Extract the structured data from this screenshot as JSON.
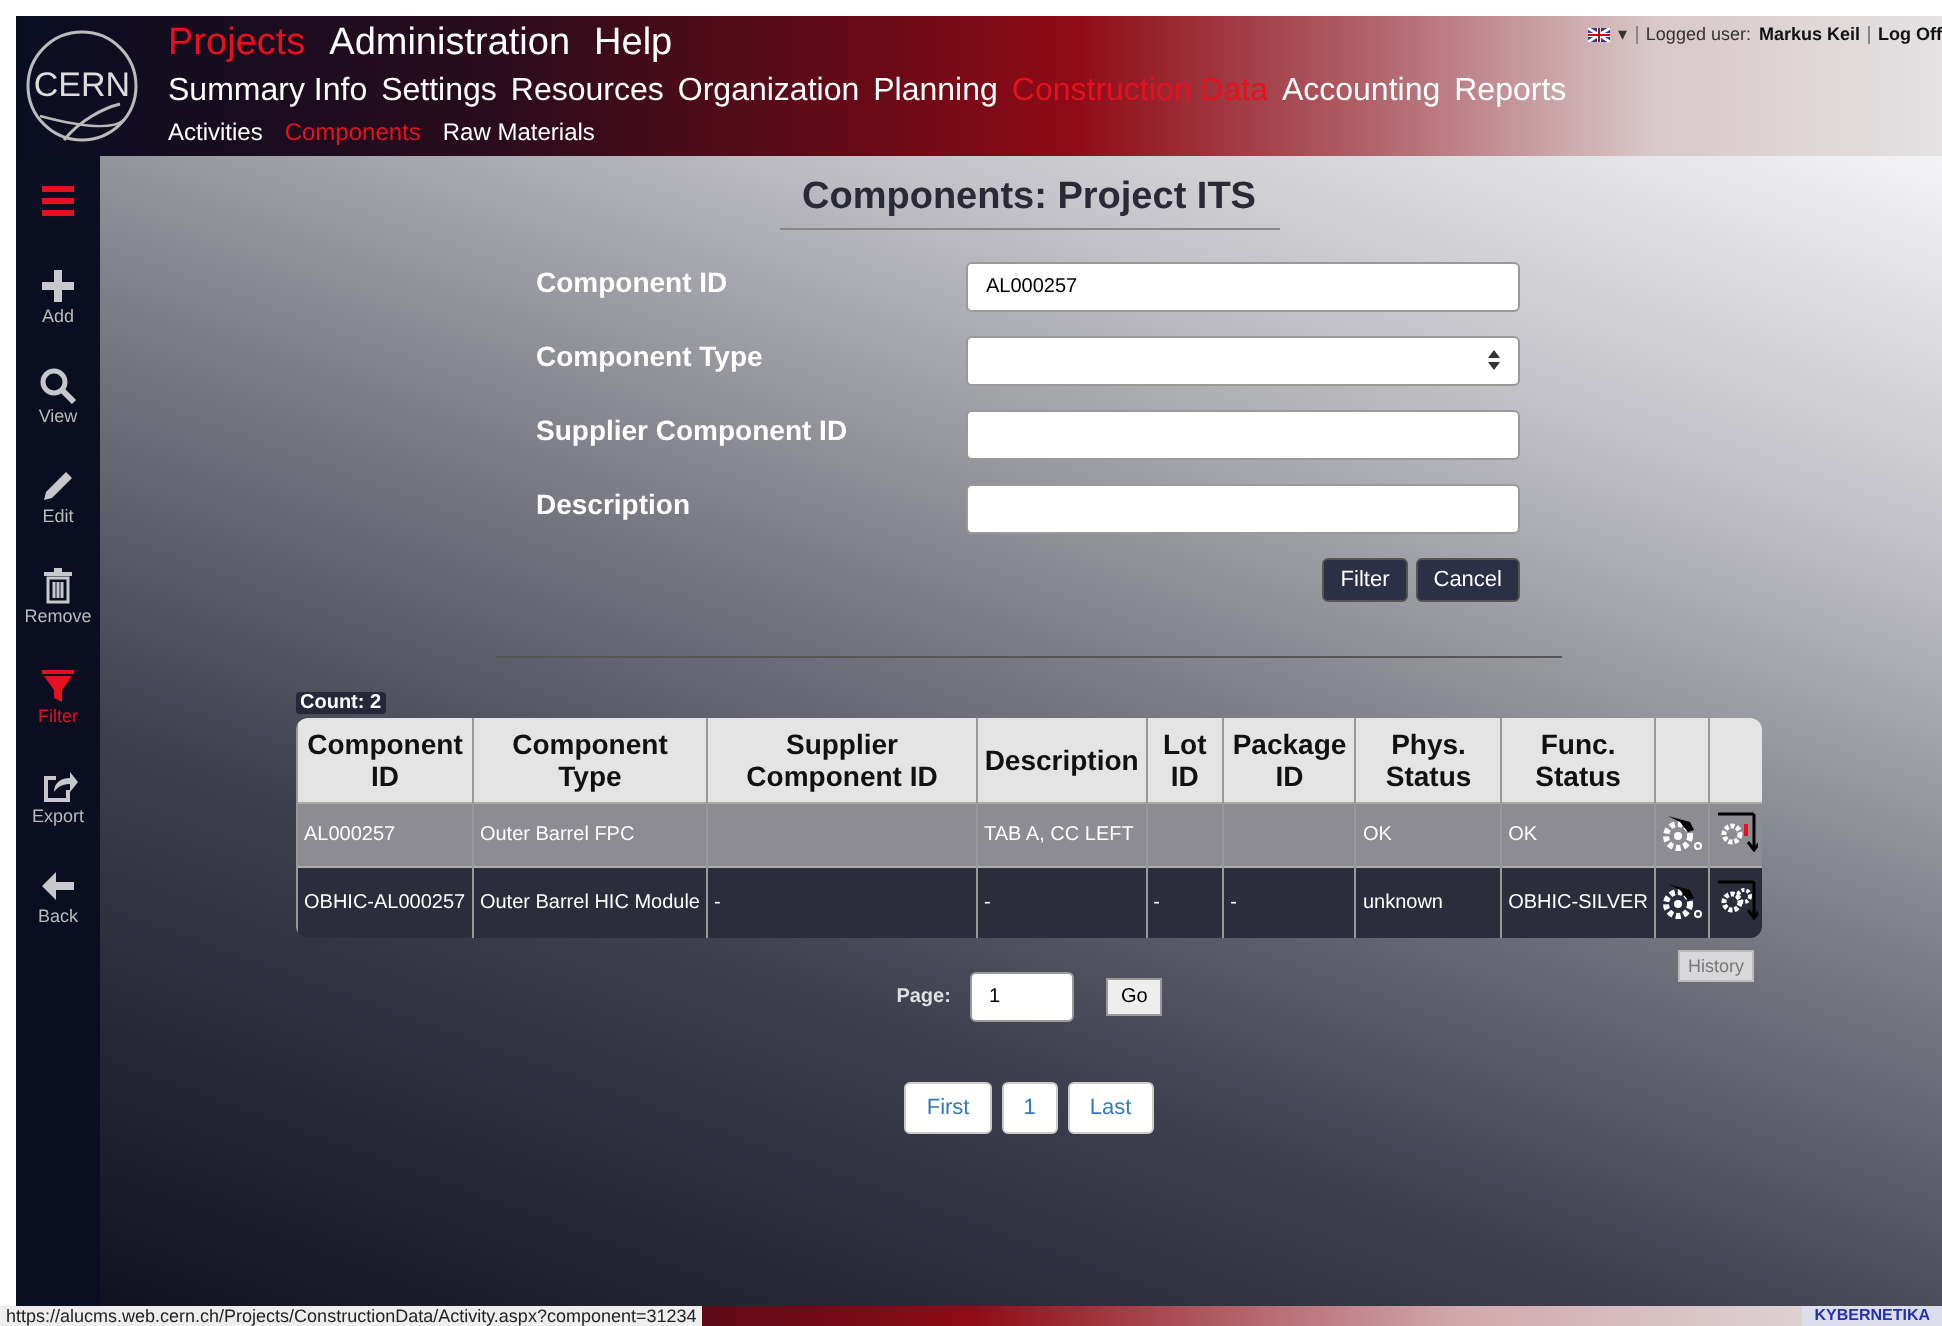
{
  "logo": {
    "text": "CERN"
  },
  "nav_main": [
    {
      "label": "Projects",
      "selected": true
    },
    {
      "label": "Administration",
      "selected": false
    },
    {
      "label": "Help",
      "selected": false
    }
  ],
  "nav_second": [
    {
      "label": "Summary Info",
      "selected": false
    },
    {
      "label": "Settings",
      "selected": false
    },
    {
      "label": "Resources",
      "selected": false
    },
    {
      "label": "Organization",
      "selected": false
    },
    {
      "label": "Planning",
      "selected": false
    },
    {
      "label": "Construction Data",
      "selected": true
    },
    {
      "label": "Accounting",
      "selected": false
    },
    {
      "label": "Reports",
      "selected": false
    }
  ],
  "nav_third": [
    {
      "label": "Activities",
      "selected": false
    },
    {
      "label": "Components",
      "selected": true
    },
    {
      "label": "Raw Materials",
      "selected": false
    }
  ],
  "user": {
    "caret": "▾",
    "label": "Logged user:",
    "name": "Markus Keil",
    "logoff": "Log Off"
  },
  "sidebar": {
    "items": [
      {
        "kind": "add",
        "label": "Add",
        "selected": false
      },
      {
        "kind": "view",
        "label": "View",
        "selected": false
      },
      {
        "kind": "edit",
        "label": "Edit",
        "selected": false
      },
      {
        "kind": "remove",
        "label": "Remove",
        "selected": false
      },
      {
        "kind": "filter",
        "label": "Filter",
        "selected": true
      },
      {
        "kind": "export",
        "label": "Export",
        "selected": false
      },
      {
        "kind": "back",
        "label": "Back",
        "selected": false
      }
    ]
  },
  "title": "Components: Project ITS",
  "form": {
    "fields": [
      {
        "kind": "text",
        "label": "Component ID",
        "value": "AL000257"
      },
      {
        "kind": "select",
        "label": "Component Type"
      },
      {
        "kind": "text",
        "label": "Supplier Component ID"
      },
      {
        "kind": "text",
        "label": "Description"
      }
    ],
    "buttons": [
      "Filter",
      "Cancel"
    ]
  },
  "count": "Count: 2",
  "table": {
    "columns": [
      "Component ID",
      "Component Type",
      "Supplier Component ID",
      "Description",
      "Lot ID",
      "Package ID",
      "Phys. Status",
      "Func. Status"
    ],
    "rows": [
      {
        "selected": true,
        "cells": [
          "AL000257",
          "Outer Barrel FPC",
          null,
          "TAB A, CC LEFT",
          null,
          null,
          "OK",
          "OK"
        ],
        "alert": true
      },
      {
        "selected": false,
        "cells": [
          "OBHIC-AL000257",
          "Outer Barrel HIC Module",
          "-",
          "-",
          "-",
          "-",
          "unknown",
          "OBHIC-SILVER"
        ],
        "alert": false
      }
    ]
  },
  "history_button": "History",
  "pager": {
    "label": "Page:",
    "value": "1",
    "go": "Go",
    "pages": [
      "First",
      "1",
      "Last"
    ]
  },
  "status_url": "https://alucms.web.cern.ch/Projects/ConstructionData/Activity.aspx?component=31234",
  "footer_logo": "KYBERNETIKA"
}
